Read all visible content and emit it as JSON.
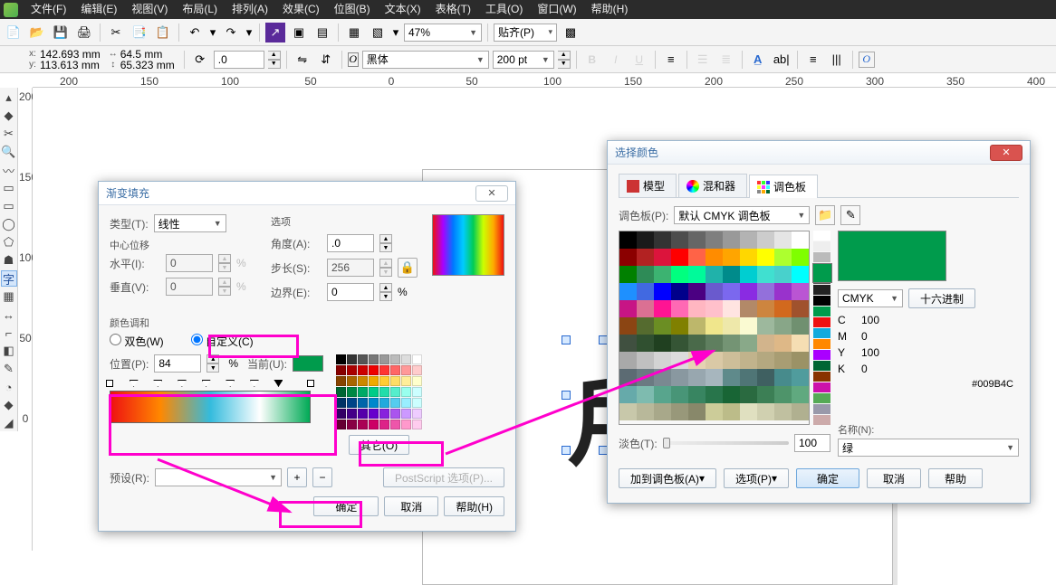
{
  "menu": {
    "items": [
      "文件(F)",
      "编辑(E)",
      "视图(V)",
      "布局(L)",
      "排列(A)",
      "效果(C)",
      "位图(B)",
      "文本(X)",
      "表格(T)",
      "工具(O)",
      "窗口(W)",
      "帮助(H)"
    ]
  },
  "toolbar1": {
    "zoom": "47%",
    "snap": "贴齐(P)"
  },
  "propbar": {
    "coord_x": "142.693 mm",
    "coord_y": "113.613 mm",
    "dim_w": "64.5 mm",
    "dim_h": "65.323 mm",
    "rotation": ".0",
    "font": "黑体",
    "fontSize": "200 pt"
  },
  "ruler_h": [
    "200",
    "150",
    "100",
    "50",
    "0",
    "50",
    "100",
    "150",
    "200",
    "250",
    "300",
    "350",
    "400"
  ],
  "ruler_v": [
    "200",
    "150",
    "100",
    "50",
    "0"
  ],
  "selection_glyph": "戶",
  "gradDlg": {
    "title": "渐变填充",
    "type_label": "类型(T):",
    "type_value": "线性",
    "options_label": "选项",
    "center_label": "中心位移",
    "horiz_label": "水平(I):",
    "horiz_value": "0",
    "vert_label": "垂直(V):",
    "vert_value": "0",
    "pct": "%",
    "angle_label": "角度(A):",
    "angle_value": ".0",
    "steps_label": "步长(S):",
    "steps_value": "256",
    "edge_label": "边界(E):",
    "edge_value": "0",
    "harmony_label": "颜色调和",
    "two_label": "双色(W)",
    "custom_label": "自定义(C)",
    "pos_label": "位置(P):",
    "pos_value": "84",
    "current_label": "当前(U):",
    "other_btn": "其它(O)",
    "preset_label": "预设(R):",
    "ps_btn": "PostScript 选项(P)...",
    "ok": "确定",
    "cancel": "取消",
    "help": "帮助(H)",
    "gradient_stops_pct": [
      0,
      12,
      24,
      36,
      48,
      60,
      72,
      84,
      100
    ]
  },
  "colorDlg": {
    "title": "选择颜色",
    "tab_model": "模型",
    "tab_mixer": "混和器",
    "tab_palette": "调色板",
    "palette_label": "调色板(P):",
    "palette_value": "默认 CMYK 调色板",
    "tint_label": "淡色(T):",
    "tint_value": "100",
    "add_btn": "加到调色板(A)",
    "options_btn": "选项(P)",
    "ok": "确定",
    "cancel": "取消",
    "help": "帮助",
    "mode": "CMYK",
    "hex_btn": "十六进制",
    "C_lbl": "C",
    "C_val": "100",
    "M_lbl": "M",
    "M_val": "0",
    "Y_lbl": "Y",
    "Y_val": "100",
    "K_lbl": "K",
    "K_val": "0",
    "hex": "#009B4C",
    "name_label": "名称(N):",
    "name_value": "绿"
  },
  "palette_colors": [
    "#000000",
    "#1a1a1a",
    "#333333",
    "#4d4d4d",
    "#666666",
    "#7f7f7f",
    "#999999",
    "#b3b3b3",
    "#cccccc",
    "#e5e5e5",
    "#ffffff",
    "#8b0000",
    "#b22222",
    "#dc143c",
    "#ff0000",
    "#ff6347",
    "#ff8c00",
    "#ffa500",
    "#ffd700",
    "#ffff00",
    "#adff2f",
    "#7fff00",
    "#008000",
    "#2e8b57",
    "#3cb371",
    "#00ff7f",
    "#00fa9a",
    "#20b2aa",
    "#008b8b",
    "#00ced1",
    "#40e0d0",
    "#48d1cc",
    "#00ffff",
    "#1e90ff",
    "#4169e1",
    "#0000ff",
    "#00008b",
    "#4b0082",
    "#6a5acd",
    "#7b68ee",
    "#8a2be2",
    "#9370db",
    "#9932cc",
    "#ba55d3",
    "#c71585",
    "#db7093",
    "#ff1493",
    "#ff69b4",
    "#ffb6c1",
    "#ffc0cb",
    "#ffe4e1",
    "#b28968",
    "#cd853f",
    "#d2691e",
    "#a0522d",
    "#8b4513",
    "#556b2f",
    "#6b8e23",
    "#808000",
    "#bdb76b",
    "#f0e68c",
    "#eee8aa",
    "#fafad2",
    "#9db89d",
    "#88a688",
    "#709070",
    "#405040",
    "#305030",
    "#204020",
    "#355535",
    "#4a6a4a",
    "#5f7f5f",
    "#749474",
    "#89a989",
    "#d2b48c",
    "#deb887",
    "#f5deb3",
    "#a9a9a9",
    "#c0c0c0",
    "#d3d3d3",
    "#dcdcdc",
    "#e6d3b3",
    "#dac9a6",
    "#cdbe99",
    "#c1b38c",
    "#b4a880",
    "#a89d73",
    "#9b9266",
    "#5c6b73",
    "#6b7a82",
    "#7a8991",
    "#8998a0",
    "#98a7af",
    "#a7b6be",
    "#5f8a8b",
    "#4f7576",
    "#3f6061",
    "#478b8c",
    "#509c9d",
    "#66aaaa",
    "#7ebbaf",
    "#58a58d",
    "#489577",
    "#388561",
    "#28754b",
    "#186535",
    "#2a6a40",
    "#3c7f55",
    "#4e946a",
    "#60a97f",
    "#c8c8aa",
    "#b8b89a",
    "#a8a88a",
    "#98987a",
    "#88886a",
    "#cccc99",
    "#bcbc89",
    "#e0e0c0",
    "#d0d0b0",
    "#c0c0a0",
    "#b0b090"
  ],
  "small_swatches": [
    "#000",
    "#333",
    "#555",
    "#777",
    "#999",
    "#bbb",
    "#ddd",
    "#fff",
    "#800",
    "#a00",
    "#c00",
    "#e00",
    "#f33",
    "#f66",
    "#f99",
    "#fcc",
    "#840",
    "#a60",
    "#c80",
    "#ea0",
    "#fc3",
    "#fd6",
    "#fe9",
    "#ffc",
    "#063",
    "#084",
    "#0a6",
    "#0c8",
    "#2da",
    "#5ec",
    "#9fe",
    "#cff",
    "#036",
    "#048",
    "#06a",
    "#08c",
    "#2ad",
    "#5ce",
    "#9ef",
    "#cff",
    "#306",
    "#408",
    "#50a",
    "#60c",
    "#82d",
    "#a5e",
    "#c9f",
    "#ecf",
    "#603",
    "#804",
    "#a05",
    "#c06",
    "#d28",
    "#e5a",
    "#f9c",
    "#fce"
  ],
  "vstrip_colors": [
    "#fff",
    "#eee",
    "#bbb",
    "#888",
    "#555",
    "#222",
    "#000",
    "#009b4c",
    "#e11",
    "#1ad",
    "#f80",
    "#a0f",
    "#063",
    "#830",
    "#c1a",
    "#5a5",
    "#99a",
    "#caa"
  ]
}
